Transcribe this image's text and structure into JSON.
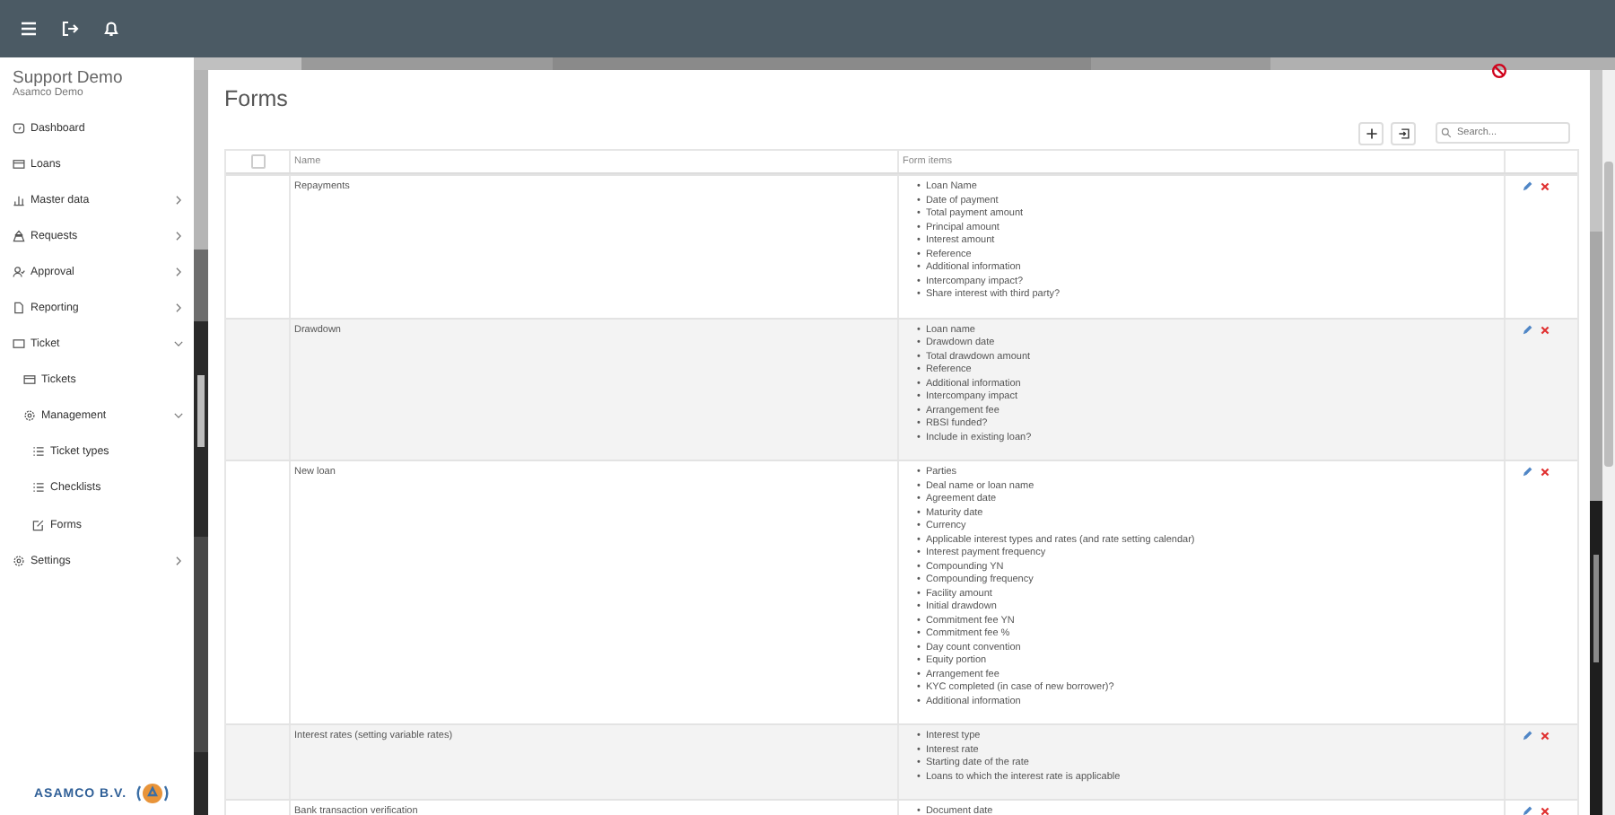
{
  "sidebar": {
    "title": "Support Demo",
    "subtitle": "Asamco Demo",
    "logo_text": "ASAMCO B.V.",
    "items": [
      {
        "label": "Dashboard"
      },
      {
        "label": "Loans"
      },
      {
        "label": "Master data",
        "expanded": false
      },
      {
        "label": "Requests",
        "expanded": false
      },
      {
        "label": "Approval",
        "expanded": false
      },
      {
        "label": "Reporting",
        "expanded": false
      },
      {
        "label": "Ticket",
        "expanded": true,
        "children": [
          {
            "label": "Tickets"
          },
          {
            "label": "Management",
            "expanded": true,
            "children": [
              {
                "label": "Ticket types"
              },
              {
                "label": "Checklists"
              },
              {
                "label": "Forms"
              }
            ]
          }
        ]
      },
      {
        "label": "Settings",
        "expanded": false
      }
    ]
  },
  "page": {
    "title": "Forms",
    "search": {
      "placeholder": "Search..."
    }
  },
  "table": {
    "select_all_checked": false,
    "bullet": "•",
    "columns": [
      "Name",
      "Form items"
    ],
    "rows": [
      {
        "name": "Repayments",
        "items": [
          "Loan Name",
          "Date of payment",
          "Total payment amount",
          "Principal amount",
          "Interest amount",
          "Reference",
          "Additional information",
          "Intercompany impact?",
          "Share interest with third party?"
        ]
      },
      {
        "name": "Drawdown",
        "items": [
          "Loan name",
          "Drawdown date",
          "Total drawdown amount",
          "Reference",
          "Additional information",
          "Intercompany impact",
          "Arrangement fee",
          "RBSI funded?",
          "Include in existing loan?"
        ]
      },
      {
        "name": "New loan",
        "items": [
          "Parties",
          "Deal name or loan name",
          "Agreement date",
          "Maturity date",
          "Currency",
          "Applicable interest types and rates (and rate setting calendar)",
          "Interest payment frequency",
          "Compounding YN",
          "Compounding frequency",
          "Facility amount",
          "Initial drawdown",
          "Commitment fee YN",
          "Commitment fee %",
          "Day count convention",
          "Equity portion",
          "Arrangement fee",
          "KYC completed (in case of new borrower)?",
          "Additional information"
        ]
      },
      {
        "name": "Interest rates (setting variable rates)",
        "items": [
          "Interest type",
          "Interest rate",
          "Starting date of the rate",
          "Loans to which the interest rate is applicable"
        ]
      },
      {
        "name": "Bank transaction verification",
        "items": [
          "Document date"
        ]
      }
    ]
  }
}
